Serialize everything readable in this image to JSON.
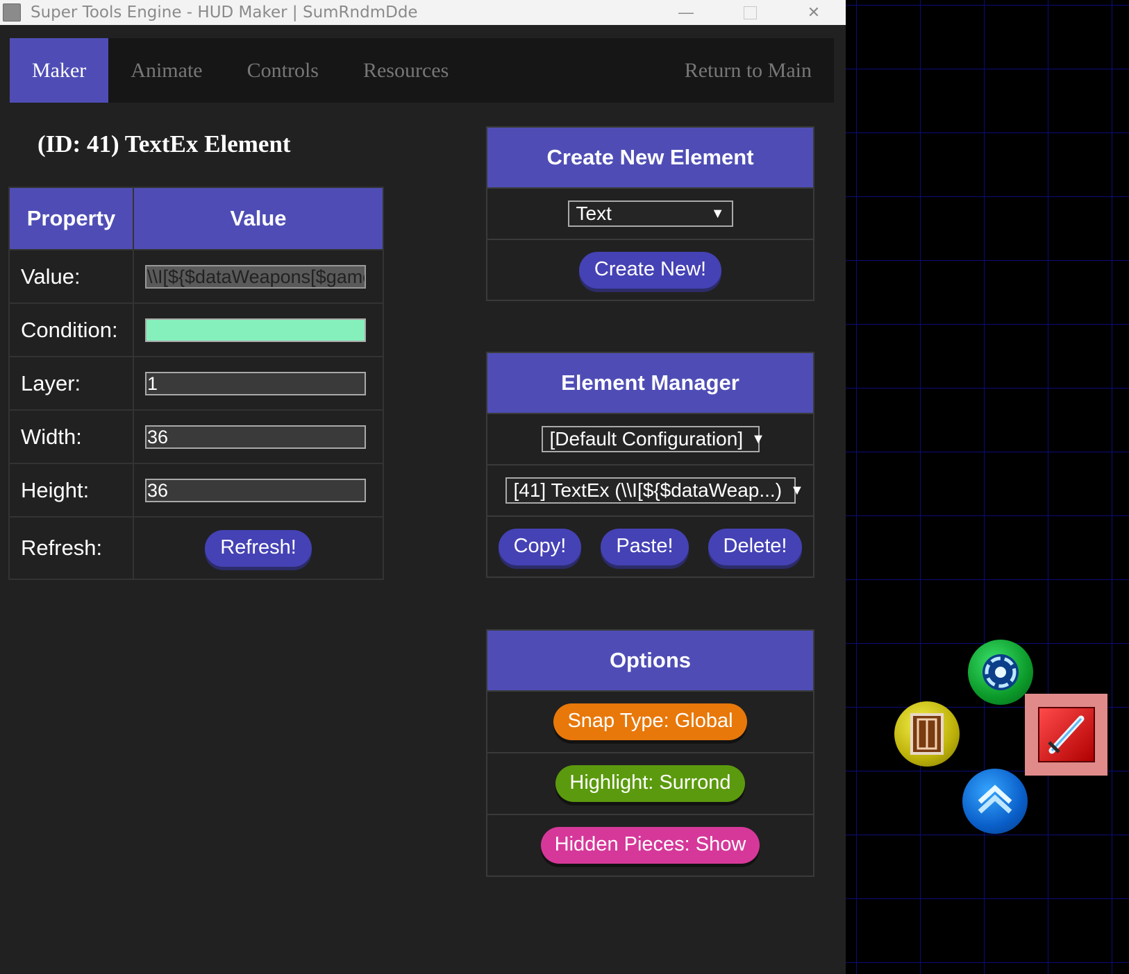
{
  "window": {
    "title": "Super Tools Engine  -  HUD Maker  |  SumRndmDde",
    "controls": {
      "minimize": "—",
      "close": "✕"
    }
  },
  "nav": {
    "tabs": [
      "Maker",
      "Animate",
      "Controls",
      "Resources"
    ],
    "return_label": "Return to Main"
  },
  "element": {
    "title": "(ID: 41) TextEx Element"
  },
  "props_table": {
    "headers": [
      "Property",
      "Value"
    ],
    "rows": [
      {
        "label": "Value:",
        "value": "\\\\I[${$dataWeapons[$game"
      },
      {
        "label": "Condition:",
        "value": ""
      },
      {
        "label": "Layer:",
        "value": "1"
      },
      {
        "label": "Width:",
        "value": "36"
      },
      {
        "label": "Height:",
        "value": "36"
      },
      {
        "label": "Refresh:",
        "button": "Refresh!"
      }
    ]
  },
  "create_panel": {
    "title": "Create New Element",
    "type_select": "Text",
    "create_button": "Create New!"
  },
  "manager_panel": {
    "title": "Element Manager",
    "config_select": "[Default Configuration]",
    "element_select": "[41] TextEx (\\\\I[${$dataWeap...)",
    "copy_button": "Copy!",
    "paste_button": "Paste!",
    "delete_button": "Delete!"
  },
  "options_panel": {
    "title": "Options",
    "snap": "Snap Type: Global",
    "highlight": "Highlight: Surrond",
    "hidden": "Hidden Pieces: Show"
  },
  "colors": {
    "accent": "#4f4db5",
    "button": "#4542b5",
    "snap": "#e8780a",
    "highlight": "#5b9a0e",
    "hidden": "#d6389a",
    "condition_field": "#86f0bd"
  },
  "hud_icons": [
    "swirl-icon",
    "door-icon",
    "sword-icon",
    "level-up-icon"
  ]
}
